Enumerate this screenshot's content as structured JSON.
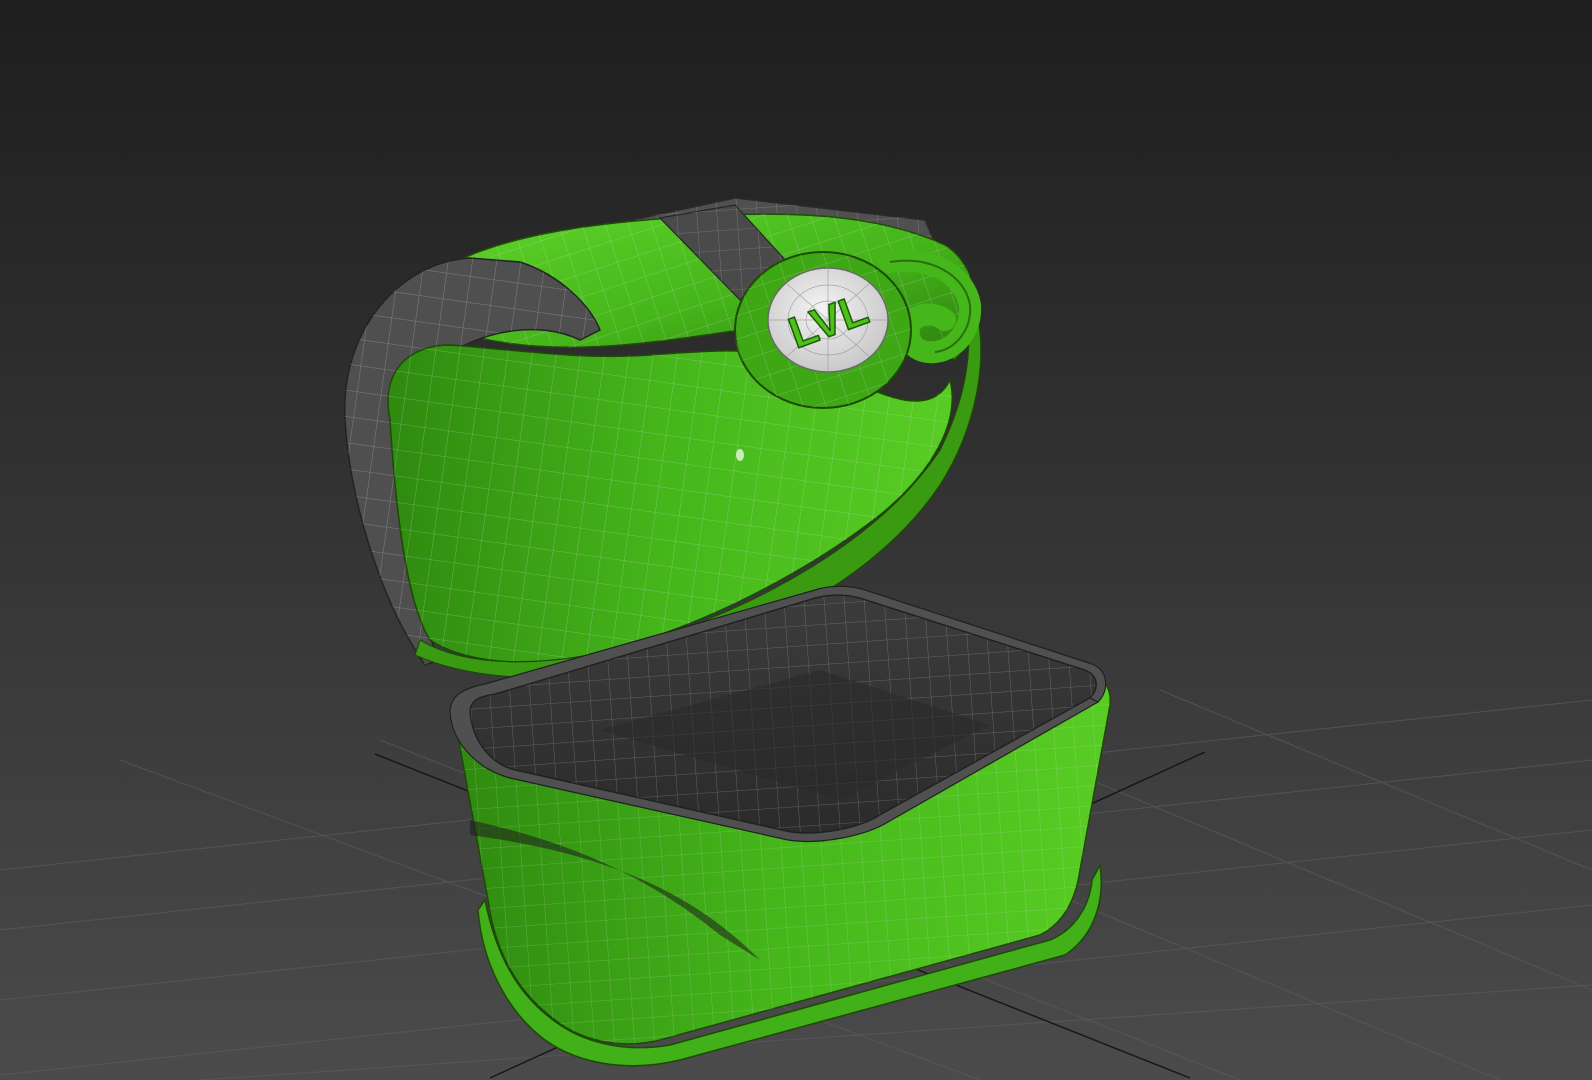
{
  "viewport": {
    "background_top": "#1f1f1f",
    "background_bottom": "#4a4a4a",
    "grid_color": "#5a5a5a",
    "grid_axis_color": "#111111"
  },
  "model": {
    "accent_color": "#4cc21a",
    "accent_dark": "#2e7f0c",
    "rubber_color": "#4a4a4a",
    "wire_color": "#d8d8d8",
    "badge": {
      "text": "LVL",
      "face_color": "#e6e6e6",
      "text_color": "#4cc21a"
    }
  }
}
